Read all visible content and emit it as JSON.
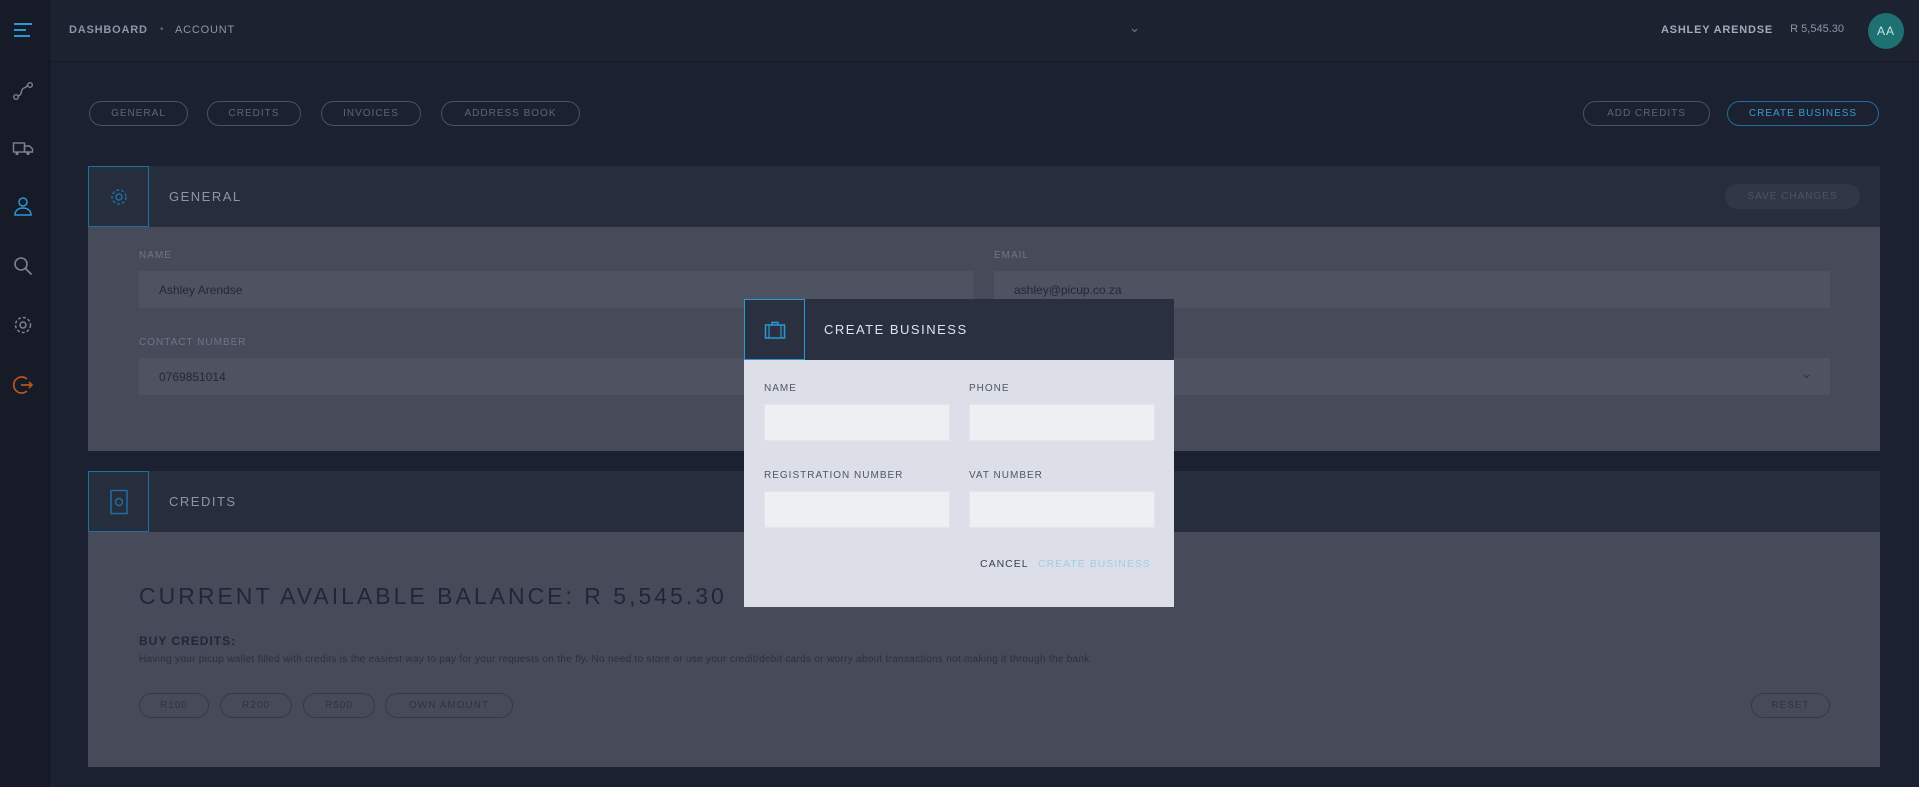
{
  "sidebar": {
    "icons": [
      "menu-icon",
      "route-icon",
      "truck-icon",
      "user-icon",
      "search-icon",
      "gear-icon",
      "logout-icon"
    ]
  },
  "topbar": {
    "breadcrumb": [
      "DASHBOARD",
      "ACCOUNT"
    ],
    "user_name": "ASHLEY ARENDSE",
    "user_balance": "R 5,545.30",
    "avatar_initials": "AA"
  },
  "tabs": [
    "GENERAL",
    "CREDITS",
    "INVOICES",
    "ADDRESS BOOK"
  ],
  "actions": {
    "add_credits": "ADD CREDITS",
    "create_business": "CREATE BUSINESS"
  },
  "general": {
    "title": "GENERAL",
    "save_label": "SAVE CHANGES",
    "name_label": "NAME",
    "name_value": "Ashley Arendse",
    "email_label": "EMAIL",
    "email_value": "ashley@picup.co.za",
    "contact_label": "CONTACT NUMBER",
    "contact_value": "0769851014"
  },
  "credits": {
    "title": "CREDITS",
    "balance_heading": "CURRENT AVAILABLE BALANCE: R 5,545.30",
    "buy_title": "BUY CREDITS:",
    "buy_description": "Having your picup wallet filled with credits is the easiest way to pay for your requests on the fly. No need to store or use your credit/debit cards or worry about transactions not making it through the bank.",
    "options": [
      "R100",
      "R200",
      "R500",
      "OWN AMOUNT"
    ],
    "reset_label": "RESET"
  },
  "modal": {
    "title": "CREATE BUSINESS",
    "name_label": "NAME",
    "name_value": "",
    "phone_label": "PHONE",
    "phone_value": "",
    "registration_label": "REGISTRATION NUMBER",
    "registration_value": "",
    "vat_label": "VAT NUMBER",
    "vat_value": "",
    "cancel_label": "CANCEL",
    "submit_label": "CREATE BUSINESS"
  },
  "colors": {
    "accent": "#2b97d3",
    "background": "#1b2130",
    "modal_body": "#dcdfe7",
    "avatar": "#1e7071",
    "logout": "#b5561e"
  }
}
